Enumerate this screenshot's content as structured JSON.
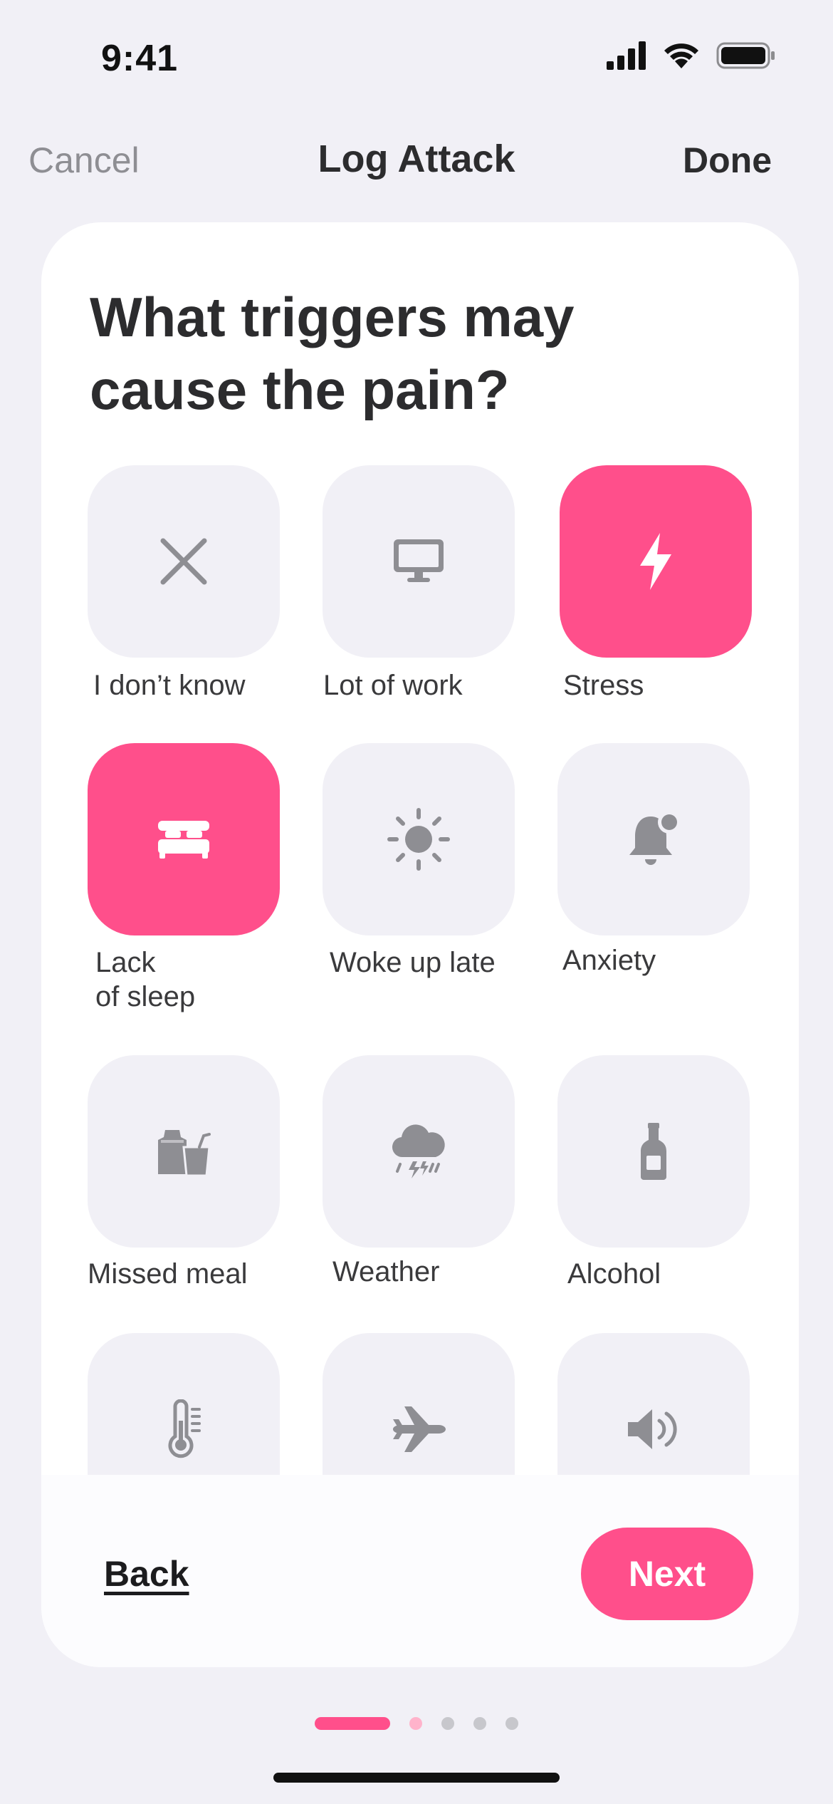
{
  "status_bar": {
    "time": "9:41"
  },
  "nav": {
    "cancel": "Cancel",
    "title": "Log Attack",
    "done": "Done"
  },
  "question": "What triggers may cause the pain?",
  "triggers": [
    {
      "label": "I don’t know",
      "icon": "x-mark-icon",
      "selected": false
    },
    {
      "label": "Lot of work",
      "icon": "desktop-monitor-icon",
      "selected": false
    },
    {
      "label": "Stress",
      "icon": "lightning-bolt-icon",
      "selected": true
    },
    {
      "label": "Lack\nof sleep",
      "icon": "bed-icon",
      "selected": true
    },
    {
      "label": "Woke up late",
      "icon": "sun-icon",
      "selected": false
    },
    {
      "label": "Anxiety",
      "icon": "bell-badge-icon",
      "selected": false
    },
    {
      "label": "Missed meal",
      "icon": "food-bag-drink-icon",
      "selected": false
    },
    {
      "label": "Weather",
      "icon": "thunderstorm-cloud-icon",
      "selected": false
    },
    {
      "label": "Alcohol",
      "icon": "bottle-icon",
      "selected": false
    },
    {
      "label": "",
      "icon": "thermometer-icon",
      "selected": false
    },
    {
      "label": "",
      "icon": "airplane-icon",
      "selected": false
    },
    {
      "label": "",
      "icon": "speaker-volume-icon",
      "selected": false
    }
  ],
  "footer": {
    "back": "Back",
    "next": "Next"
  },
  "pager": {
    "total": 5,
    "current": 1
  },
  "colors": {
    "accent": "#ff4f8b",
    "tile": "#f1f0f6",
    "icon_gray": "#8e8e93"
  }
}
